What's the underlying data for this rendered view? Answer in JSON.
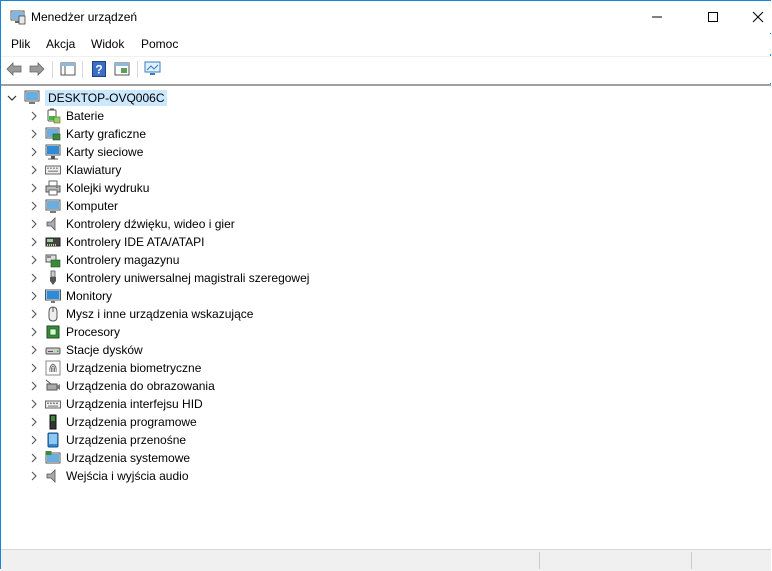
{
  "window": {
    "title": "Menedżer urządzeń"
  },
  "menu": [
    "Plik",
    "Akcja",
    "Widok",
    "Pomoc"
  ],
  "tree": {
    "root": "DESKTOP-OVQ006C",
    "items": [
      {
        "label": "Baterie",
        "icon": "battery-icon"
      },
      {
        "label": "Karty graficzne",
        "icon": "display-adapter-icon"
      },
      {
        "label": "Karty sieciowe",
        "icon": "network-adapter-icon"
      },
      {
        "label": "Klawiatury",
        "icon": "keyboard-icon"
      },
      {
        "label": "Kolejki wydruku",
        "icon": "printer-icon"
      },
      {
        "label": "Komputer",
        "icon": "computer-icon"
      },
      {
        "label": "Kontrolery dźwięku, wideo i gier",
        "icon": "speaker-icon"
      },
      {
        "label": "Kontrolery IDE ATA/ATAPI",
        "icon": "ide-controller-icon"
      },
      {
        "label": "Kontrolery magazynu",
        "icon": "storage-controller-icon"
      },
      {
        "label": "Kontrolery uniwersalnej magistrali szeregowej",
        "icon": "usb-icon"
      },
      {
        "label": "Monitory",
        "icon": "monitor-icon"
      },
      {
        "label": "Mysz i inne urządzenia wskazujące",
        "icon": "mouse-icon"
      },
      {
        "label": "Procesory",
        "icon": "processor-icon"
      },
      {
        "label": "Stacje dysków",
        "icon": "disk-drive-icon"
      },
      {
        "label": "Urządzenia biometryczne",
        "icon": "fingerprint-icon"
      },
      {
        "label": "Urządzenia do obrazowania",
        "icon": "camera-icon"
      },
      {
        "label": "Urządzenia interfejsu HID",
        "icon": "hid-icon"
      },
      {
        "label": "Urządzenia programowe",
        "icon": "software-device-icon"
      },
      {
        "label": "Urządzenia przenośne",
        "icon": "portable-device-icon"
      },
      {
        "label": "Urządzenia systemowe",
        "icon": "system-device-icon"
      },
      {
        "label": "Wejścia i wyjścia audio",
        "icon": "audio-io-icon"
      }
    ]
  }
}
